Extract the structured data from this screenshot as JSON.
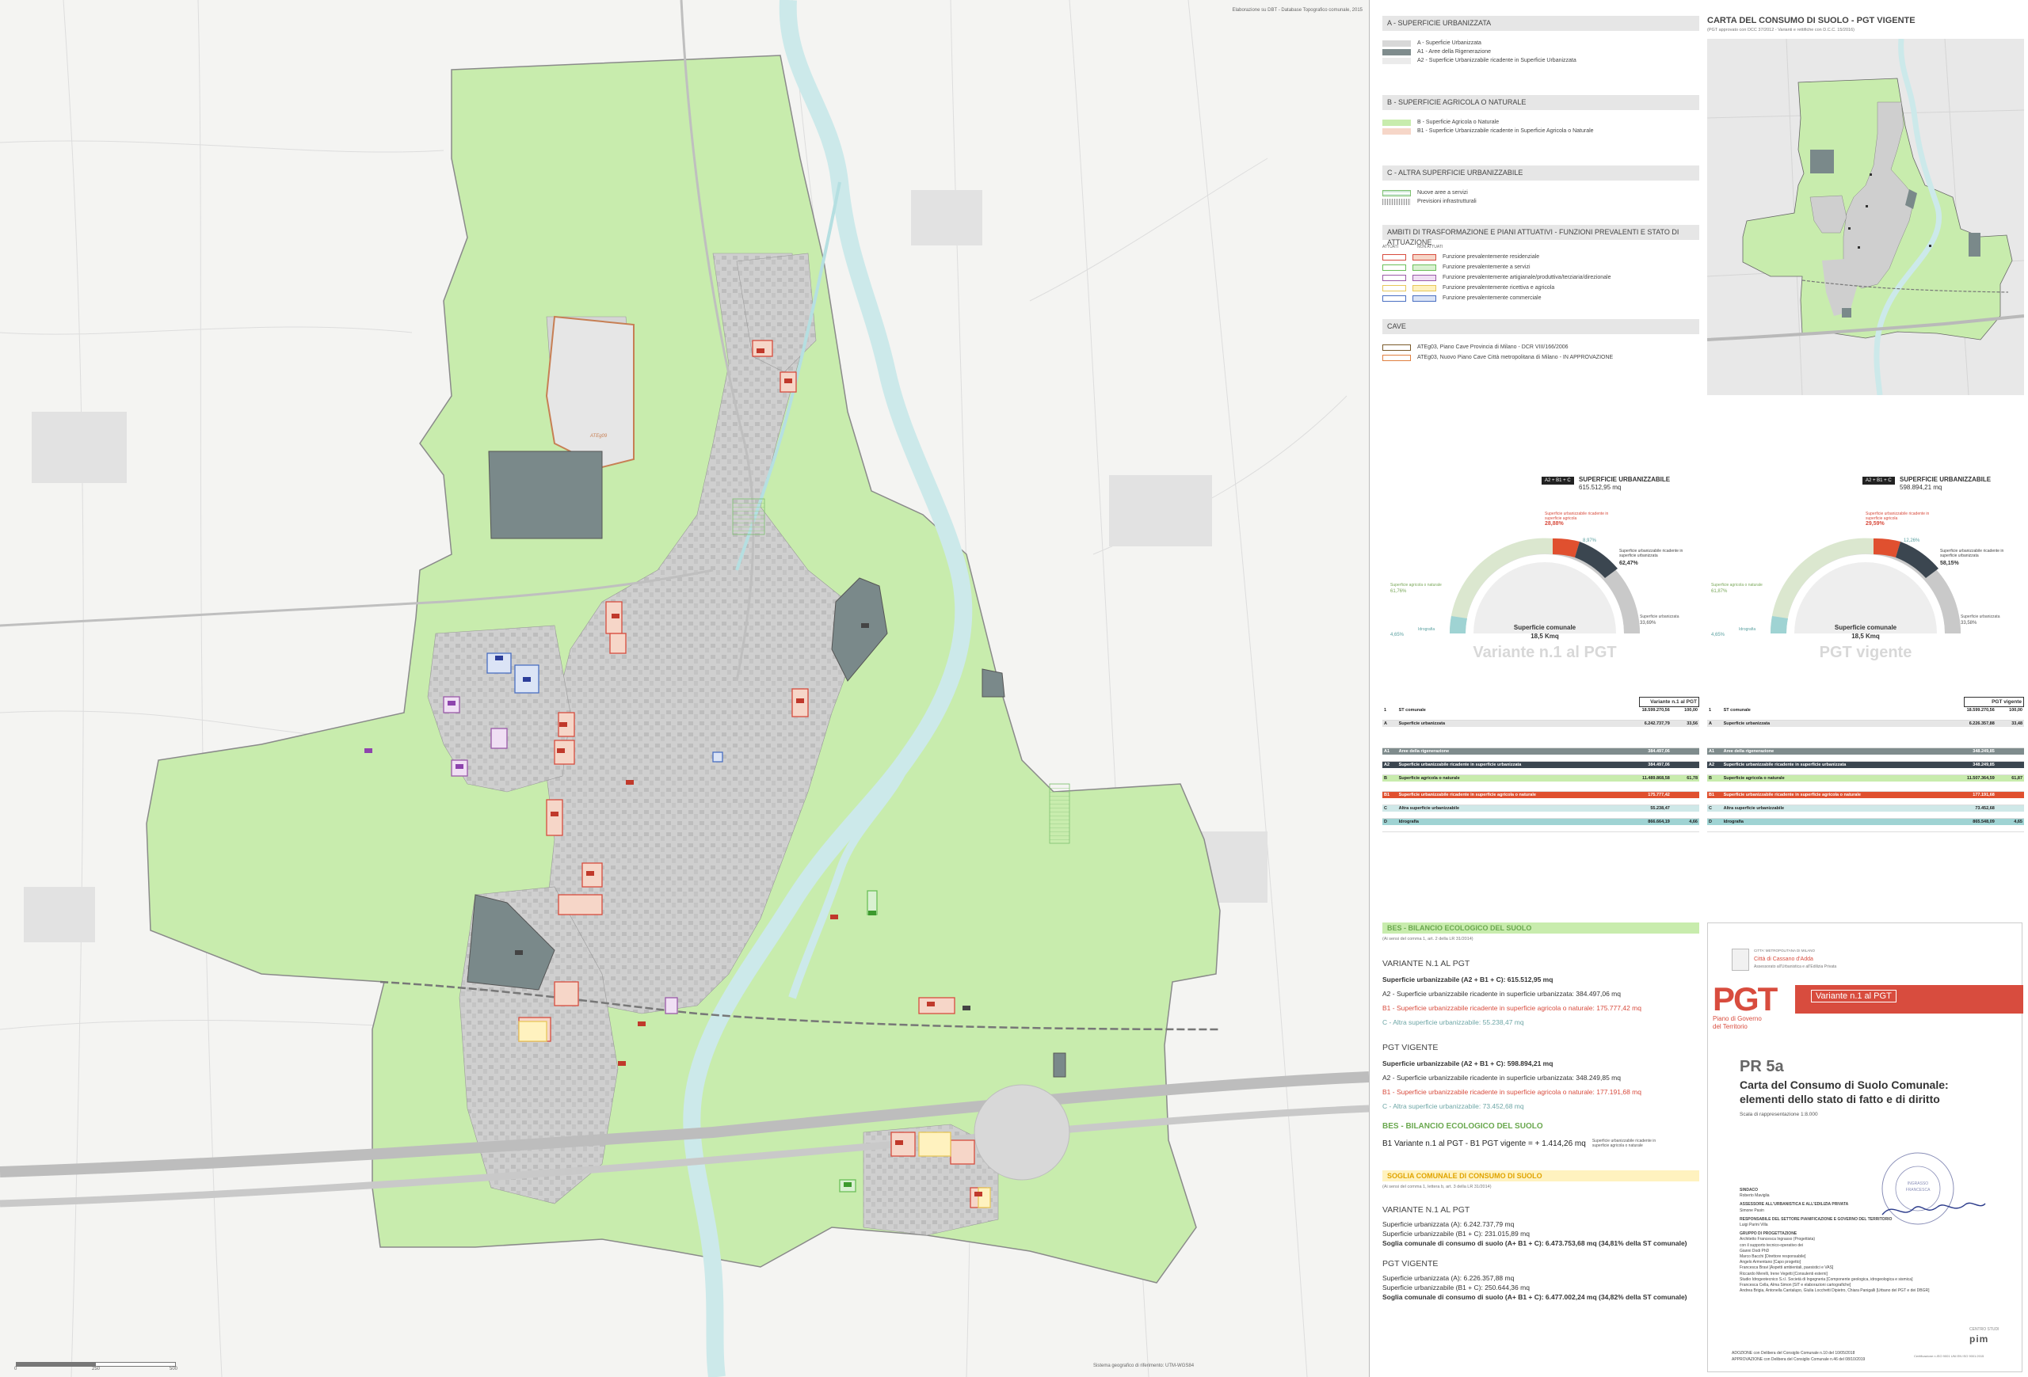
{
  "map": {
    "top_right_note": "Elaborazione su DBT - Database Topografico comunale, 2015",
    "bottom_right_note": "Sistema geografico di riferimento: UTM-WGS84",
    "scale_bar": [
      "0",
      "250",
      "500"
    ],
    "labels": {
      "atp": "ATEg09",
      "badges": [
        "ATU1",
        "ATU2",
        "ATU3",
        "ATU4",
        "ATU5",
        "ATU6",
        "ATU7",
        "ATU8",
        "ATU9",
        "ATU10",
        "ATS1",
        "ATS2",
        "ATS3",
        "PA1",
        "PA2",
        "PA3",
        "PA4",
        "PA5",
        "PII1",
        "PII2",
        "PR1",
        "PR2",
        "PR3",
        "PR4",
        "PR5",
        "PR6",
        "AT1",
        "AT2",
        "AT3",
        "AT4",
        "AT5",
        "AT6",
        "AT7",
        "AT8",
        "AT9",
        "AT10",
        "AT11",
        "AT12"
      ]
    }
  },
  "legend": {
    "sections": [
      {
        "title": "A - SUPERFICIE URBANIZZATA",
        "items": [
          {
            "label": "A - Superficie Urbanizzata",
            "color": "#d8d8d8"
          },
          {
            "label": "A1 - Aree della Rigenerazione",
            "color": "#7f8c8d"
          },
          {
            "label": "A2 - Superficie Urbanizzabile ricadente in Superficie Urbanizzata",
            "color": "#ebebeb"
          }
        ]
      },
      {
        "title": "B - SUPERFICIE AGRICOLA O NATURALE",
        "items": [
          {
            "label": "B - Superficie Agricola o Naturale",
            "color": "#c8ecad"
          },
          {
            "label": "B1 - Superficie Urbanizzabile ricadente in Superficie Agricola o Naturale",
            "color": "#f6d6c8"
          }
        ]
      },
      {
        "title": "C - ALTRA SUPERFICIE URBANIZZABILE",
        "items": [
          {
            "label": "Nuove aree a servizi",
            "color": "#cfe8d8"
          },
          {
            "label": "Previsioni infrastrutturali",
            "color": "#e0e0e0"
          }
        ]
      }
    ],
    "ambiti": {
      "title": "AMBITI DI TRASFORMAZIONE E PIANI ATTUATIVI - FUNZIONI PREVALENTI E STATO DI ATTUAZIONE",
      "col1": "ATTUATI",
      "col2": "NON ATTUATI",
      "items": [
        {
          "label": "Funzione prevalentemente residenziale",
          "color": "#d84c3e"
        },
        {
          "label": "Funzione prevalentemente a servizi",
          "color": "#6bbf59"
        },
        {
          "label": "Funzione prevalentemente artigianale/produttiva/terziaria/direzionale",
          "color": "#9a5aa8"
        },
        {
          "label": "Funzione prevalentemente ricettiva e agricola",
          "color": "#e7c75a"
        },
        {
          "label": "Funzione prevalentemente commerciale",
          "color": "#4a6fc2"
        }
      ]
    },
    "cave": {
      "title": "CAVE",
      "items": [
        {
          "label": "ATEg03, Piano Cave Provincia di Milano - DCR VIII/166/2006",
          "color": "#7a5a2a"
        },
        {
          "label": "ATEg03, Nuovo Piano Cave Città metropolitana di Milano - IN APPROVAZIONE",
          "color": "#e08040"
        }
      ]
    }
  },
  "overview": {
    "title": "CARTA DEL CONSUMO DI SUOLO - PGT VIGENTE",
    "subtitle": "(PGT approvato con DCC 37/2012 - Varianti e rettifiche con D.C.C. 15/2016)"
  },
  "gauges": [
    {
      "name": "Variante n.1 al PGT",
      "badge": "A2 + B1 + C",
      "header": "SUPERFICIE URBANIZZABILE",
      "header_value": "615.512,95 mq",
      "labels": {
        "b1": "Superficie urbanizzabile ricadente in superficie agricola",
        "b1_pct": "28,88%",
        "a2": "Superficie urbanizzabile ricadente in superficie urbanizzata",
        "a2_pct": "62,47%",
        "c_pct": "8,97%",
        "agri": "Superficie agricola o naturale",
        "agri_pct": "61,76%",
        "urb": "Superficie urbanizzata",
        "urb_pct": "33,69%",
        "idro": "Idrografia",
        "idro_pct": "4,65%",
        "center": "Superficie comunale",
        "center_value": "18,5 Kmq"
      },
      "big_title": "Variante n.1 al PGT"
    },
    {
      "name": "PGT vigente",
      "badge": "A2 + B1 + C",
      "header": "SUPERFICIE URBANIZZABILE",
      "header_value": "598.894,21 mq",
      "labels": {
        "b1": "Superficie urbanizzabile ricadente in superficie agricola",
        "b1_pct": "29,59%",
        "a2": "Superficie urbanizzabile ricadente in superficie urbanizzata",
        "a2_pct": "58,15%",
        "c_pct": "12,26%",
        "agri": "Superficie agricola o naturale",
        "agri_pct": "61,87%",
        "urb": "Superficie urbanizzata",
        "urb_pct": "33,58%",
        "idro": "Idrografia",
        "idro_pct": "4,65%",
        "center": "Superficie comunale",
        "center_value": "18,5 Kmq"
      },
      "big_title": "PGT vigente"
    }
  ],
  "tables": [
    {
      "title": "Variante n.1 al PGT",
      "rows": [
        {
          "k": "1",
          "label": "ST comunale",
          "v": "18.599.270,56",
          "p": "100,00"
        },
        {
          "k": "A",
          "label": "Superficie urbanizzata",
          "v": "6.242.737,79",
          "p": "33,56"
        },
        {
          "k": "A1",
          "label": "Aree della rigenerazione",
          "v": "384.497,06",
          "p": ""
        },
        {
          "k": "A2",
          "label": "Superficie urbanizzabile ricadente in superficie urbanizzata",
          "v": "384.497,06",
          "p": ""
        },
        {
          "k": "B",
          "label": "Superficie agricola o naturale",
          "v": "11.489.868,58",
          "p": "61,78"
        },
        {
          "k": "B1",
          "label": "Superficie urbanizzabile ricadente in superficie agricola o naturale",
          "v": "175.777,42",
          "p": ""
        },
        {
          "k": "C",
          "label": "Altra superficie urbanizzabile",
          "v": "55.238,47",
          "p": ""
        },
        {
          "k": "D",
          "label": "Idrografia",
          "v": "866.664,19",
          "p": "4,66"
        }
      ]
    },
    {
      "title": "PGT vigente",
      "rows": [
        {
          "k": "1",
          "label": "ST comunale",
          "v": "18.599.270,56",
          "p": "100,00"
        },
        {
          "k": "A",
          "label": "Superficie urbanizzata",
          "v": "6.226.357,88",
          "p": "33,48"
        },
        {
          "k": "A1",
          "label": "Aree della rigenerazione",
          "v": "348.249,85",
          "p": ""
        },
        {
          "k": "A2",
          "label": "Superficie urbanizzabile ricadente in superficie urbanizzata",
          "v": "348.249,85",
          "p": ""
        },
        {
          "k": "B",
          "label": "Superficie agricola o naturale",
          "v": "11.507.364,59",
          "p": "61,87"
        },
        {
          "k": "B1",
          "label": "Superficie urbanizzabile ricadente in superficie agricola o naturale",
          "v": "177.191,68",
          "p": ""
        },
        {
          "k": "C",
          "label": "Altra superficie urbanizzabile",
          "v": "73.452,68",
          "p": ""
        },
        {
          "k": "D",
          "label": "Idrografia",
          "v": "865.548,09",
          "p": "4,65"
        }
      ]
    }
  ],
  "bes": {
    "title": "BES - BILANCIO ECOLOGICO DEL SUOLO",
    "note": "(Ai sensi del comma 1, art. 2 della LR 31/2014)",
    "variante_title": "VARIANTE N.1 AL PGT",
    "v1": "Superficie urbanizzabile (A2 + B1 + C): 615.512,95 mq",
    "v2": "A2 - Superficie urbanizzabile ricadente in superficie urbanizzata: 384.497,06 mq",
    "v3": "B1 - Superficie urbanizzabile ricadente in superficie agricola o naturale: 175.777,42 mq",
    "v4": "C - Altra superficie urbanizzabile: 55.238,47 mq",
    "vigente_title": "PGT VIGENTE",
    "g1": "Superficie urbanizzabile (A2 + B1 + C): 598.894,21 mq",
    "g2": "A2 - Superficie urbanizzabile ricadente in superficie urbanizzata: 348.249,85 mq",
    "g3": "B1 - Superficie urbanizzabile ricadente in superficie agricola o naturale: 177.191,68 mq",
    "g4": "C - Altra superficie urbanizzabile: 73.452,68 mq",
    "bes_title": "BES - BILANCIO ECOLOGICO DEL SUOLO",
    "bes_line": "B1 Variante n.1 al PGT - B1 PGT vigente = + 1.414,26 mq",
    "bes_note": "Superficie urbanizzabile ricadente in superficie agricola o naturale"
  },
  "soglia": {
    "title": "SOGLIA COMUNALE DI CONSUMO DI SUOLO",
    "note": "(Ai sensi del comma 1, lettera b, art. 3 della LR 31/2014)",
    "variante_title": "VARIANTE N.1 AL PGT",
    "v1": "Superficie urbanizzata (A): 6.242.737,79 mq",
    "v2": "Superficie urbanizzabile (B1 + C): 231.015,89 mq",
    "v3": "Soglia comunale di consumo di suolo (A+ B1 + C): 6.473.753,68 mq (34,81% della ST comunale)",
    "vigente_title": "PGT VIGENTE",
    "g1": "Superficie urbanizzata (A): 6.226.357,88 mq",
    "g2": "Superficie urbanizzabile (B1 + C): 250.644,36 mq",
    "g3": "Soglia comunale di consumo di suolo (A+ B1 + C): 6.477.002,24 mq (34,82% della ST comunale)"
  },
  "cartouche": {
    "city_top": "CITTA' METROPOLITANA DI MILANO",
    "city": "Città di Cassano d'Adda",
    "city_sub": "Assessorato all'Urbanistica e all'Edilizia Privata",
    "brand": "PGT",
    "brand_sub1": "Piano di Governo",
    "brand_sub2": "del Territorio",
    "variant": "Variante n.1 al PGT",
    "code": "PR 5a",
    "title1": "Carta del Consumo di Suolo Comunale:",
    "title2": "elementi dello stato di fatto e di diritto",
    "scale": "Scala di rappresentazione 1:8.000",
    "credits": [
      "SINDACO",
      "Roberto Maviglia",
      "ASSESSORE ALL'URBANISTICA E ALL'EDILIZIA PRIVATA",
      "Simone Pasin",
      "RESPONSABILE DEL SETTORE PIANIFICAZIONE E GOVERNO DEL TERRITORIO",
      "Luigi Parini Villa",
      "GRUPPO DI PROGETTAZIONE",
      "Architetto Francesca Ingrasso (Progettista)",
      "con il supporto tecnico-operativo dei",
      "Gianni Dodi PhD",
      "Marco Bacchi [Direttore responsabile]",
      "Angelo Armentano [Capo progetto]",
      "Francesca Bravi [Aspetti ambientali, paesistici e VAS]",
      "Riccardo Merelli, Irene Vegetti [Consulenti esterni]",
      "Studio Idrogeotecnico S.r.l. Società di Ingegneria [Componente geologica, idrogeologica e sismica]",
      "Francesca Cella, Alma Simon [SIT e elaborazioni cartografiche]",
      "Andrea Brigia, Antonella Cantalupo, Giulia Locchetti Dipietro, Chiara Panigalli [Urbano del PGT e dei DBGR]"
    ],
    "stamp_text": "ORDINE DEGLI ARCHITETTI DELLA PROVINCIA DI MILANO INGRASSO FRANCESCA 16391",
    "adopt": "ADOZIONE con Delibera del Consiglio Comunale n.10 del 10/05/2018",
    "approve": "APPROVAZIONE con Delibera del Consiglio Comunale n.46 del 08/10/2019",
    "logo": "CENTRO STUDI",
    "logo2": "pim",
    "footnote": "Certificazione n.ISO 9001 UNI EN ISO 9001:2015"
  }
}
